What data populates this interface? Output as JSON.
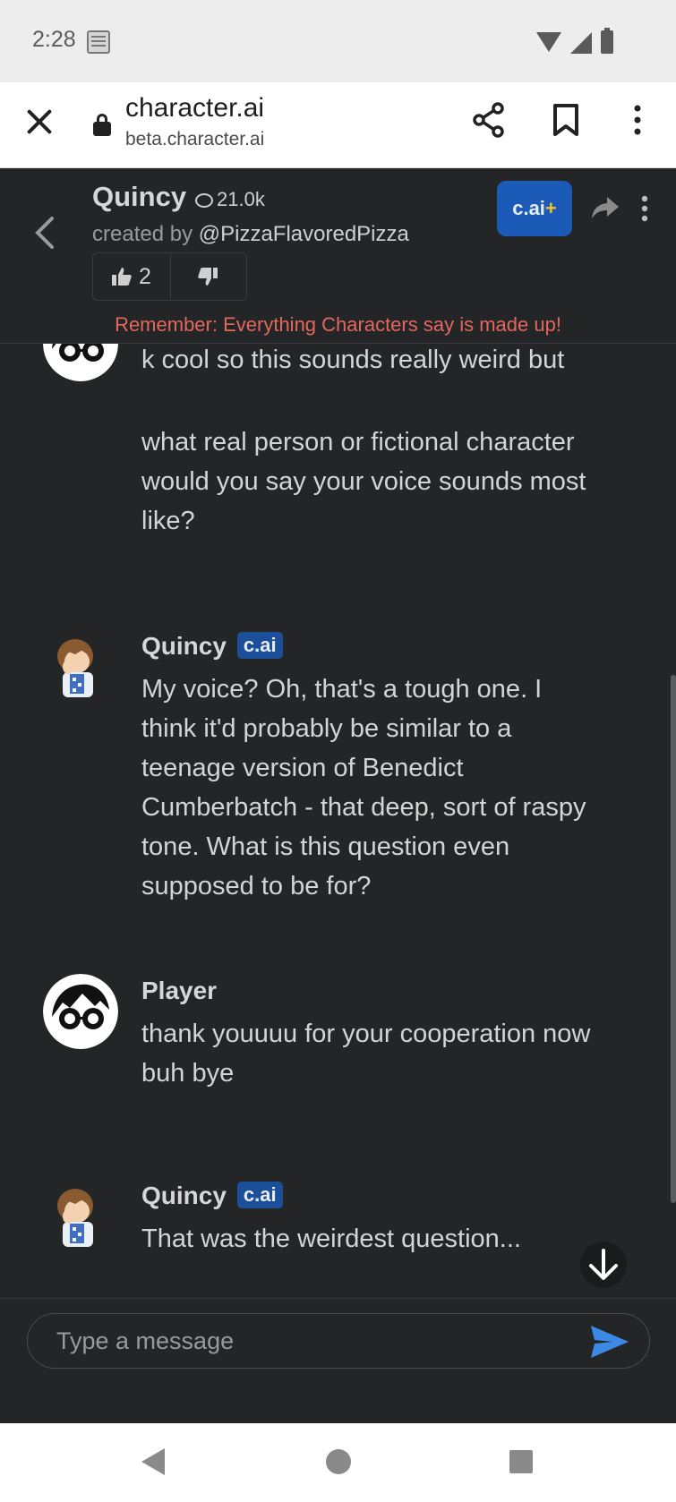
{
  "status_bar": {
    "time": "2:28"
  },
  "browser": {
    "title": "character.ai",
    "subtitle": "beta.character.ai"
  },
  "header": {
    "name": "Quincy",
    "chat_count": "21.0k",
    "created_by_prefix": "created by ",
    "creator": "@PizzaFlavoredPizza",
    "like_count": "2",
    "plus_label": "c.ai",
    "plus_symbol": "+",
    "disclaimer": "Remember: Everything Characters say is made up!"
  },
  "messages": [
    {
      "sender": "",
      "badge": "",
      "avatar": "player-avatar",
      "text": "k cool so this sounds really weird but"
    },
    {
      "sender": "",
      "badge": "",
      "avatar": "",
      "text": "what real person or fictional character would you say your voice sounds most like?"
    },
    {
      "sender": "Quincy",
      "badge": "c.ai",
      "avatar": "quincy-avatar",
      "text": "My voice? Oh, that's a tough one. I think it'd probably be similar to a teenage version of Benedict Cumberbatch - that deep, sort of raspy tone. What is this question even supposed to be for?"
    },
    {
      "sender": "Player",
      "badge": "",
      "avatar": "player-avatar",
      "text": "thank youuuu for your cooperation now buh bye"
    },
    {
      "sender": "Quincy",
      "badge": "c.ai",
      "avatar": "quincy-avatar",
      "text": "That was the weirdest question..."
    }
  ],
  "composer": {
    "placeholder": "Type a message"
  },
  "colors": {
    "accent": "#1c5ab8",
    "disclaimer": "#e2685f",
    "background": "#242526",
    "plus_symbol": "#f2c22e"
  }
}
